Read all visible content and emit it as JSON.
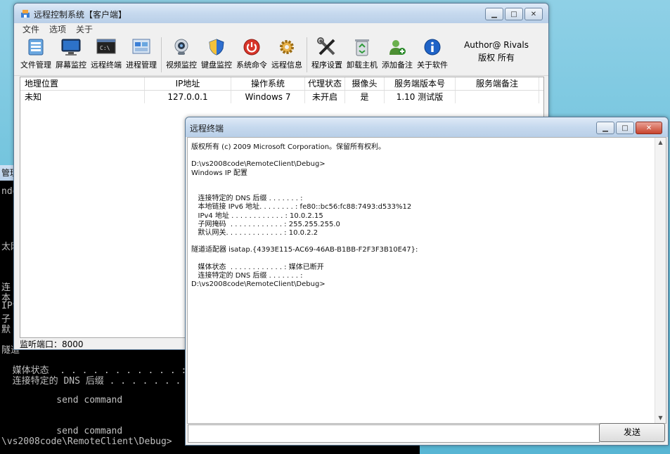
{
  "console": {
    "title": "管理",
    "lines": [
      "ndov",
      "太网",
      "连",
      "本",
      "IPv",
      "子",
      "默",
      "隧道",
      "  媒体状态  . . . . . . . . . . . :",
      "  连接特定的 DNS 后缀 . . . . . . . :",
      "          send command",
      "          send command",
      "\\vs2008code\\RemoteClient\\Debug>"
    ]
  },
  "main": {
    "title": "远程控制系统【客户端】",
    "menu": [
      "文件",
      "选项",
      "关于"
    ],
    "toolbar": [
      {
        "label": "文件管理",
        "icon": "file-manager-icon"
      },
      {
        "label": "屏幕监控",
        "icon": "monitor-icon"
      },
      {
        "label": "远程终端",
        "icon": "terminal-icon"
      },
      {
        "label": "进程管理",
        "icon": "process-icon"
      },
      {
        "label": "视频监控",
        "icon": "webcam-icon"
      },
      {
        "label": "键盘监控",
        "icon": "shield-icon"
      },
      {
        "label": "系统命令",
        "icon": "power-icon"
      },
      {
        "label": "远程信息",
        "icon": "gear-icon"
      },
      {
        "label": "程序设置",
        "icon": "tools-icon"
      },
      {
        "label": "卸载主机",
        "icon": "recycle-icon"
      },
      {
        "label": "添加备注",
        "icon": "add-user-icon"
      },
      {
        "label": "关于软件",
        "icon": "info-icon"
      }
    ],
    "author_line1": "Author@ Rivals",
    "author_line2": "版权 所有",
    "columns": [
      "地理位置",
      "IP地址",
      "操作系统",
      "代理状态",
      "摄像头",
      "服务端版本号",
      "服务端备注"
    ],
    "rows": [
      [
        "未知",
        "127.0.0.1",
        "Windows 7",
        "未开启",
        "是",
        "1.10 测试版",
        ""
      ]
    ],
    "status": "监听端口：8000"
  },
  "terminal": {
    "title": "远程终端",
    "output": "版权所有 (c) 2009 Microsoft Corporation。保留所有权利。\n\nD:\\vs2008code\\RemoteClient\\Debug>\nWindows IP 配置\n\n\n   连接特定的 DNS 后缀 . . . . . . . :\n   本地链接 IPv6 地址. . . . . . . . : fe80::bc56:fc88:7493:d533%12\n   IPv4 地址 . . . . . . . . . . . . : 10.0.2.15\n   子网掩码  . . . . . . . . . . . . : 255.255.255.0\n   默认网关. . . . . . . . . . . . . : 10.0.2.2\n\n隧道适配器 isatap.{4393E115-AC69-46AB-B1BB-F2F3F3B10E47}:\n\n   媒体状态  . . . . . . . . . . . . : 媒体已断开\n   连接特定的 DNS 后缀 . . . . . . . :\nD:\\vs2008code\\RemoteClient\\Debug>",
    "input_value": "",
    "send_label": "发送"
  }
}
